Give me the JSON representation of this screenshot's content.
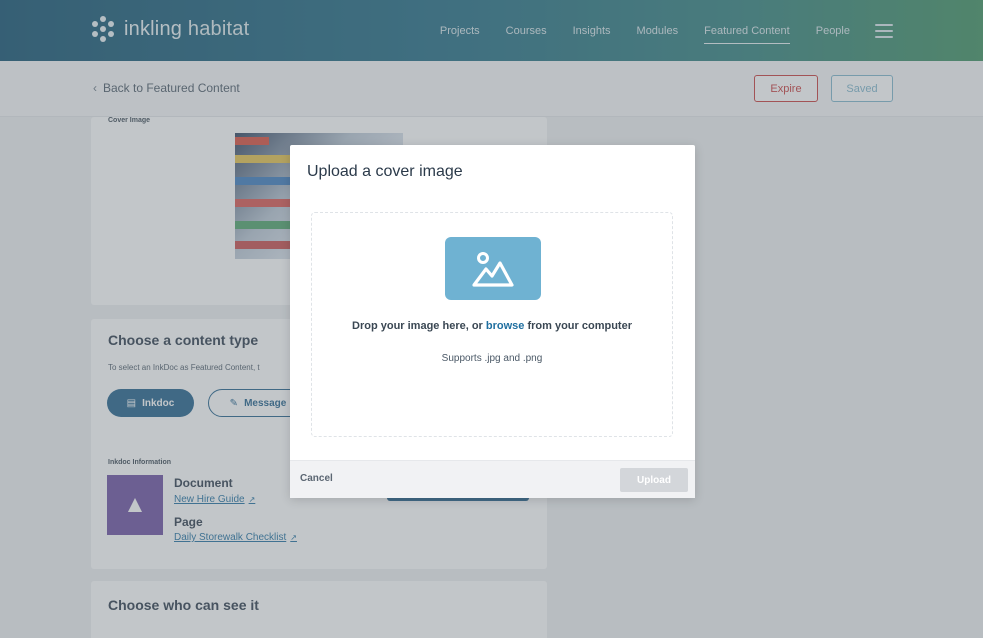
{
  "brand": {
    "name": "inkling",
    "suffix": "habitat"
  },
  "nav": {
    "items": [
      {
        "label": "Projects"
      },
      {
        "label": "Courses"
      },
      {
        "label": "Insights"
      },
      {
        "label": "Modules"
      },
      {
        "label": "Featured Content",
        "active": true
      },
      {
        "label": "People"
      }
    ]
  },
  "subheader": {
    "back_label": "Back to Featured Content",
    "expire_label": "Expire",
    "saved_label": "Saved"
  },
  "cover_section": {
    "label": "Cover Image"
  },
  "content_type": {
    "title": "Choose a content type",
    "description": "To select an InkDoc as Featured Content, t",
    "inkdoc_label": "Inkdoc",
    "message_label": "Message"
  },
  "inkdoc_info": {
    "label": "Inkdoc Information",
    "document_heading": "Document",
    "document_link": "New Hire Guide",
    "page_heading": "Page",
    "page_link": "Daily Storewalk Checklist"
  },
  "visibility": {
    "title": "Choose who can see it"
  },
  "modal": {
    "title": "Upload a cover image",
    "drop_prefix": "Drop your image here, or ",
    "drop_browse": "browse",
    "drop_suffix": " from your computer",
    "supports": "Supports .jpg and .png",
    "cancel_label": "Cancel",
    "upload_label": "Upload"
  },
  "colors": {
    "accent": "#1f5f8b",
    "danger": "#c83a3a",
    "upload_icon_bg": "#6fb2d2",
    "disabled": "#d3d6da"
  }
}
